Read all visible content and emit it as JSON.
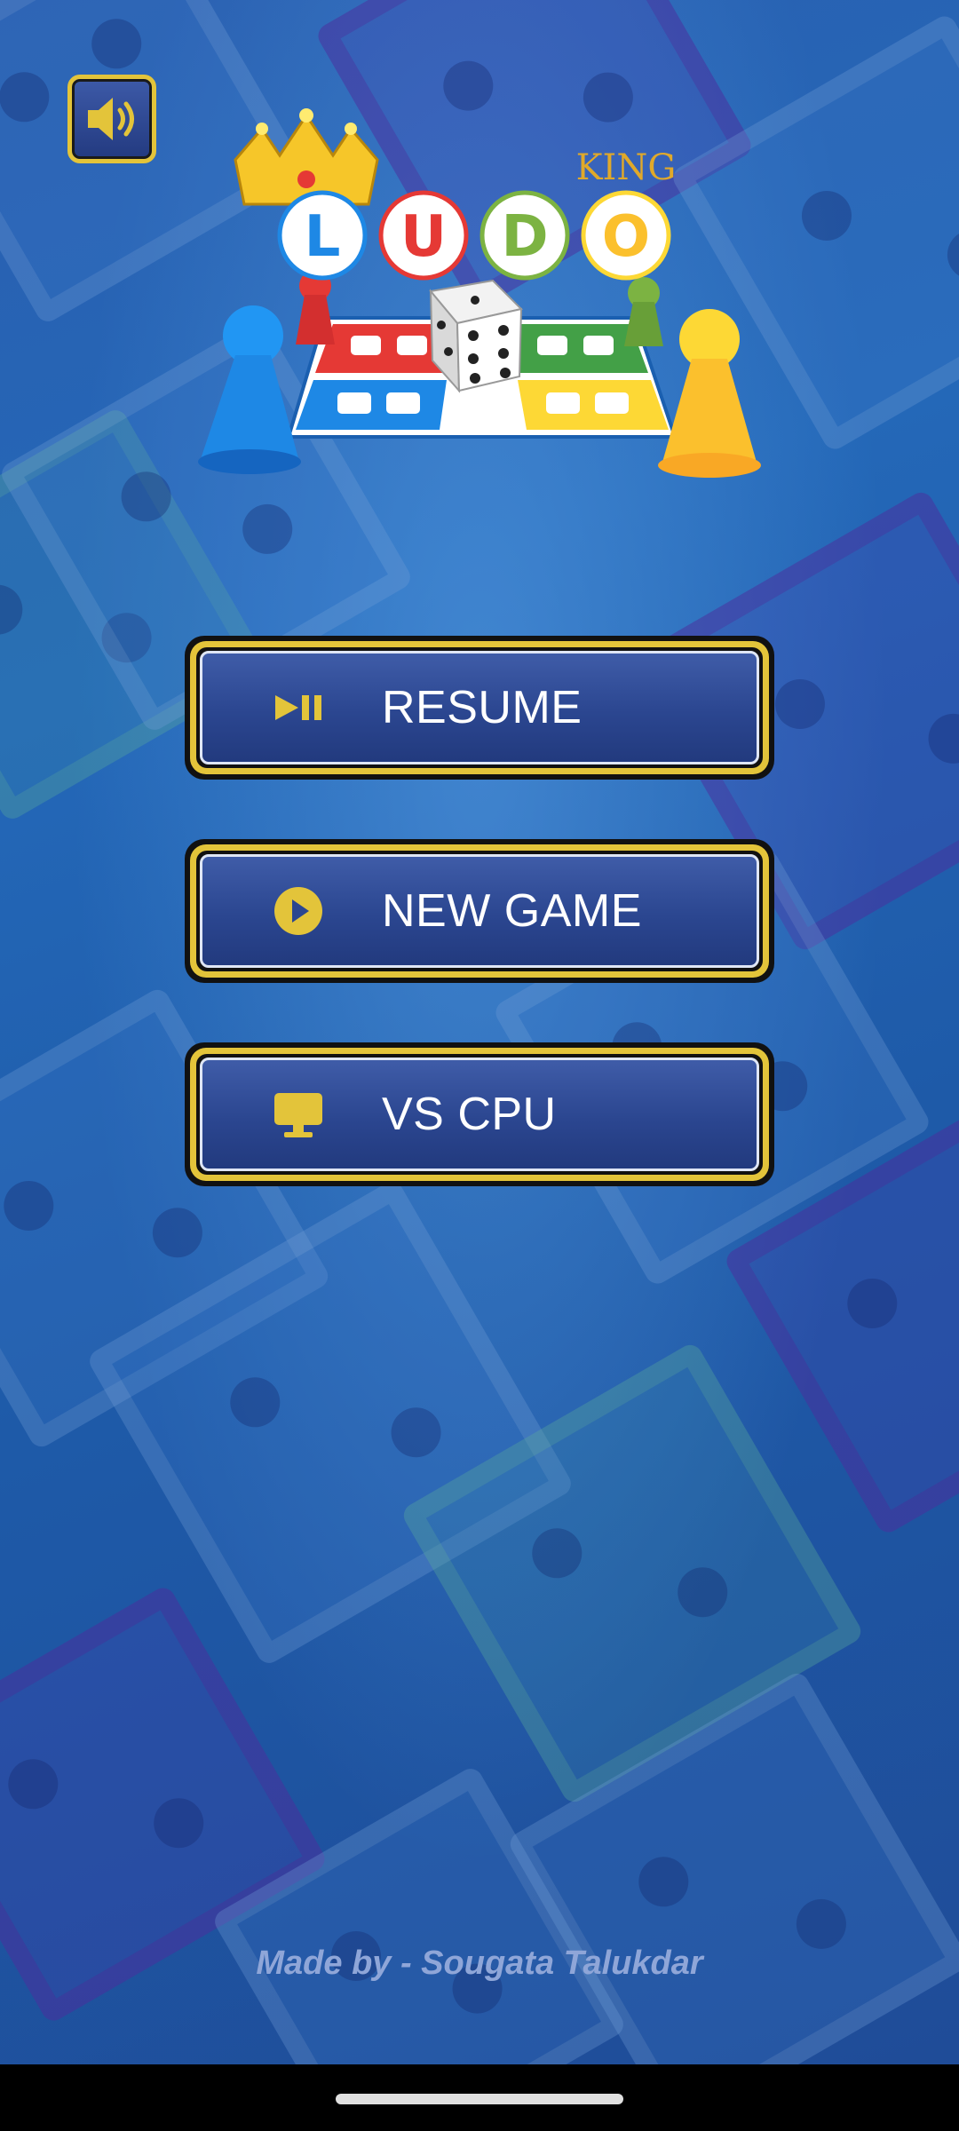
{
  "app": {
    "logo_text_top": "KING",
    "logo_letters": [
      "L",
      "U",
      "D",
      "O"
    ]
  },
  "sound_button": {
    "icon": "speaker-icon",
    "state": "on"
  },
  "menu": {
    "buttons": [
      {
        "label": "RESUME",
        "icon": "play-pause-icon"
      },
      {
        "label": "NEW GAME",
        "icon": "play-circle-icon"
      },
      {
        "label": "VS CPU",
        "icon": "monitor-icon"
      }
    ]
  },
  "footer": {
    "credit": "Made by - Sougata Talukdar"
  },
  "colors": {
    "accent_gold": "#e3c43a",
    "button_blue": "#2b4690",
    "background_blue": "#1e5aa8"
  }
}
